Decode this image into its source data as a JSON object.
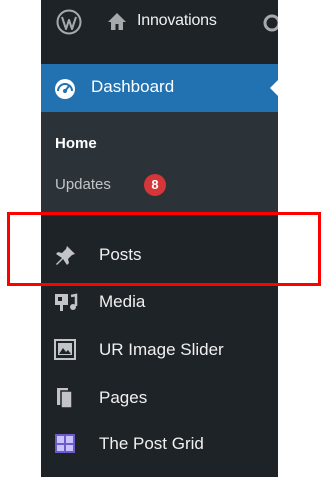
{
  "adminbar": {
    "logo_icon": "wordpress-logo-icon",
    "home_icon": "home-icon",
    "site_name": "Innovations"
  },
  "sidebar": {
    "dashboard": {
      "label": "Dashboard",
      "icon": "dashboard-icon"
    },
    "submenu": {
      "home": "Home",
      "updates": "Updates",
      "updates_count": "8"
    },
    "items": [
      {
        "label": "Posts",
        "icon": "pin-icon"
      },
      {
        "label": "Media",
        "icon": "media-icon"
      },
      {
        "label": "UR Image Slider",
        "icon": "image-slider-icon"
      },
      {
        "label": "Pages",
        "icon": "pages-icon"
      },
      {
        "label": "The Post Grid",
        "icon": "post-grid-icon"
      }
    ]
  },
  "colors": {
    "sidebar_bg": "#1d2327",
    "submenu_bg": "#2c3338",
    "active_bg": "#2271b1",
    "badge_bg": "#d63638",
    "highlight_border": "#ff0000"
  }
}
